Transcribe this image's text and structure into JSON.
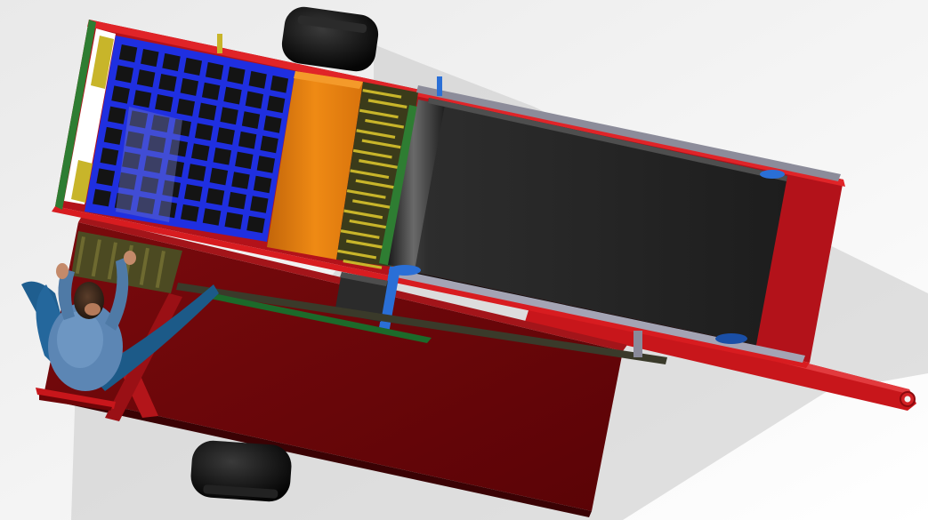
{
  "scene": {
    "subject": "harvester-machine-cad-render",
    "view": "top-down-isometric",
    "background": "#f4f4f4"
  },
  "colors": {
    "frame_red": "#c8161b",
    "deck_dark_red": "#6e0508",
    "deck_mid_red": "#8a0a0e",
    "grid_blue": "#1f2fe0",
    "hopper_orange": "#e07a0a",
    "belt_dark": "#262626",
    "belt_edge": "#151515",
    "rail_green": "#2e7d32",
    "bar_yellow": "#c8b52a",
    "tire_black": "#0d0d0d",
    "shaft_blue": "#2a6fd6",
    "operator_shirt": "#5c86b4",
    "operator_dark": "#1a2a3a",
    "shadow_grey": "#bdbdbd"
  },
  "components": [
    "top-wheel",
    "bottom-wheel",
    "screen-grid",
    "orange-hopper",
    "conveyor-belt",
    "chain-rollers",
    "drawbar",
    "operator-figure",
    "base-deck"
  ]
}
